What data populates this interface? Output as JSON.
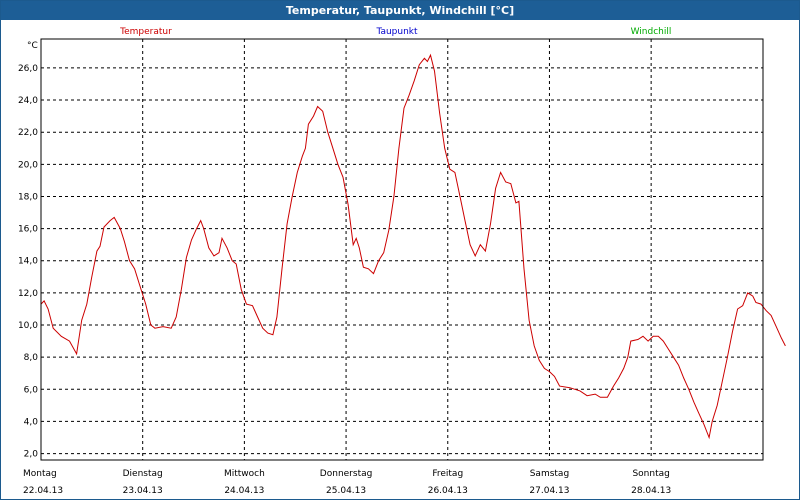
{
  "window": {
    "title": "Temperatur, Taupunkt, Windchill [°C]"
  },
  "chart_data": {
    "type": "line",
    "ylabel": "°C",
    "ylim": [
      1.6,
      27.8
    ],
    "yticks": [
      "2,0",
      "4,0",
      "6,0",
      "8,0",
      "10,0",
      "12,0",
      "14,0",
      "16,0",
      "18,0",
      "20,0",
      "22,0",
      "24,0",
      "26,0"
    ],
    "ytick_values": [
      2,
      4,
      6,
      8,
      10,
      12,
      14,
      16,
      18,
      20,
      22,
      24,
      26
    ],
    "xlim": [
      0,
      7.1
    ],
    "grid": true,
    "legend": [
      {
        "name": "Temperatur",
        "color": "#cc0000"
      },
      {
        "name": "Taupunkt",
        "color": "#0000cc"
      },
      {
        "name": "Windchill",
        "color": "#00aa00"
      }
    ],
    "days": [
      {
        "weekday": "Montag",
        "date": "22.04.13"
      },
      {
        "weekday": "Dienstag",
        "date": "23.04.13"
      },
      {
        "weekday": "Mittwoch",
        "date": "24.04.13"
      },
      {
        "weekday": "Donnerstag",
        "date": "25.04.13"
      },
      {
        "weekday": "Freitag",
        "date": "26.04.13"
      },
      {
        "weekday": "Samstag",
        "date": "27.04.13"
      },
      {
        "weekday": "Sonntag",
        "date": "28.04.13"
      }
    ],
    "series": [
      {
        "name": "Temperatur",
        "color": "#cc0000",
        "points": [
          [
            0.0,
            11.3
          ],
          [
            0.03,
            11.5
          ],
          [
            0.07,
            11.0
          ],
          [
            0.12,
            9.8
          ],
          [
            0.2,
            9.3
          ],
          [
            0.28,
            9.0
          ],
          [
            0.35,
            8.2
          ],
          [
            0.4,
            10.3
          ],
          [
            0.45,
            11.3
          ],
          [
            0.5,
            13.0
          ],
          [
            0.55,
            14.6
          ],
          [
            0.58,
            14.9
          ],
          [
            0.62,
            16.1
          ],
          [
            0.68,
            16.5
          ],
          [
            0.72,
            16.7
          ],
          [
            0.78,
            16.0
          ],
          [
            0.82,
            15.2
          ],
          [
            0.87,
            14.0
          ],
          [
            0.92,
            13.5
          ],
          [
            0.97,
            12.5
          ],
          [
            1.03,
            11.3
          ],
          [
            1.08,
            10.0
          ],
          [
            1.12,
            9.8
          ],
          [
            1.2,
            9.9
          ],
          [
            1.28,
            9.8
          ],
          [
            1.33,
            10.5
          ],
          [
            1.38,
            12.2
          ],
          [
            1.43,
            14.2
          ],
          [
            1.48,
            15.3
          ],
          [
            1.53,
            16.0
          ],
          [
            1.57,
            16.5
          ],
          [
            1.6,
            16.0
          ],
          [
            1.65,
            14.8
          ],
          [
            1.7,
            14.3
          ],
          [
            1.75,
            14.5
          ],
          [
            1.78,
            15.4
          ],
          [
            1.83,
            14.8
          ],
          [
            1.88,
            14.0
          ],
          [
            1.92,
            13.8
          ],
          [
            1.97,
            12.2
          ],
          [
            2.02,
            11.3
          ],
          [
            2.08,
            11.2
          ],
          [
            2.13,
            10.5
          ],
          [
            2.18,
            9.8
          ],
          [
            2.23,
            9.5
          ],
          [
            2.28,
            9.4
          ],
          [
            2.32,
            10.5
          ],
          [
            2.37,
            13.5
          ],
          [
            2.42,
            16.3
          ],
          [
            2.47,
            18.0
          ],
          [
            2.52,
            19.5
          ],
          [
            2.57,
            20.5
          ],
          [
            2.6,
            21.0
          ],
          [
            2.63,
            22.5
          ],
          [
            2.68,
            23.0
          ],
          [
            2.72,
            23.6
          ],
          [
            2.77,
            23.3
          ],
          [
            2.82,
            22.0
          ],
          [
            2.87,
            21.0
          ],
          [
            2.92,
            20.0
          ],
          [
            2.97,
            19.2
          ],
          [
            3.02,
            17.5
          ],
          [
            3.07,
            15.0
          ],
          [
            3.1,
            15.4
          ],
          [
            3.13,
            14.8
          ],
          [
            3.17,
            13.6
          ],
          [
            3.22,
            13.5
          ],
          [
            3.27,
            13.2
          ],
          [
            3.32,
            14.0
          ],
          [
            3.37,
            14.5
          ],
          [
            3.42,
            15.9
          ],
          [
            3.47,
            18.0
          ],
          [
            3.52,
            21.0
          ],
          [
            3.57,
            23.5
          ],
          [
            3.62,
            24.3
          ],
          [
            3.67,
            25.2
          ],
          [
            3.72,
            26.2
          ],
          [
            3.77,
            26.6
          ],
          [
            3.8,
            26.4
          ],
          [
            3.83,
            26.8
          ],
          [
            3.87,
            25.8
          ],
          [
            3.92,
            23.2
          ],
          [
            3.97,
            21.0
          ],
          [
            4.02,
            19.7
          ],
          [
            4.07,
            19.5
          ],
          [
            4.12,
            18.0
          ],
          [
            4.17,
            16.5
          ],
          [
            4.22,
            15.0
          ],
          [
            4.27,
            14.3
          ],
          [
            4.32,
            15.0
          ],
          [
            4.37,
            14.6
          ],
          [
            4.42,
            16.3
          ],
          [
            4.47,
            18.5
          ],
          [
            4.52,
            19.5
          ],
          [
            4.57,
            18.9
          ],
          [
            4.62,
            18.8
          ],
          [
            4.67,
            17.6
          ],
          [
            4.7,
            17.7
          ],
          [
            4.75,
            13.5
          ],
          [
            4.8,
            10.3
          ],
          [
            4.85,
            8.7
          ],
          [
            4.9,
            7.8
          ],
          [
            4.95,
            7.3
          ],
          [
            5.0,
            7.1
          ],
          [
            5.05,
            6.8
          ],
          [
            5.1,
            6.2
          ],
          [
            5.2,
            6.1
          ],
          [
            5.3,
            5.9
          ],
          [
            5.37,
            5.6
          ],
          [
            5.45,
            5.7
          ],
          [
            5.5,
            5.5
          ],
          [
            5.57,
            5.5
          ],
          [
            5.63,
            6.2
          ],
          [
            5.68,
            6.7
          ],
          [
            5.73,
            7.3
          ],
          [
            5.77,
            8.0
          ],
          [
            5.8,
            9.0
          ],
          [
            5.87,
            9.1
          ],
          [
            5.92,
            9.3
          ],
          [
            5.97,
            9.0
          ],
          [
            6.02,
            9.3
          ],
          [
            6.07,
            9.3
          ],
          [
            6.12,
            9.0
          ],
          [
            6.17,
            8.5
          ],
          [
            6.22,
            8.0
          ],
          [
            6.27,
            7.5
          ],
          [
            6.32,
            6.7
          ],
          [
            6.37,
            6.0
          ],
          [
            6.42,
            5.2
          ],
          [
            6.47,
            4.5
          ],
          [
            6.52,
            3.8
          ],
          [
            6.57,
            3.0
          ],
          [
            6.6,
            4.0
          ],
          [
            6.65,
            5.0
          ],
          [
            6.7,
            6.5
          ],
          [
            6.75,
            8.0
          ],
          [
            6.8,
            9.6
          ],
          [
            6.85,
            11.0
          ],
          [
            6.9,
            11.2
          ],
          [
            6.95,
            12.0
          ],
          [
            7.0,
            11.8
          ],
          [
            7.03,
            11.4
          ],
          [
            7.08,
            11.3
          ],
          [
            7.13,
            10.9
          ],
          [
            7.18,
            10.6
          ],
          [
            7.23,
            9.9
          ],
          [
            7.28,
            9.2
          ],
          [
            7.32,
            8.7
          ]
        ]
      }
    ]
  }
}
